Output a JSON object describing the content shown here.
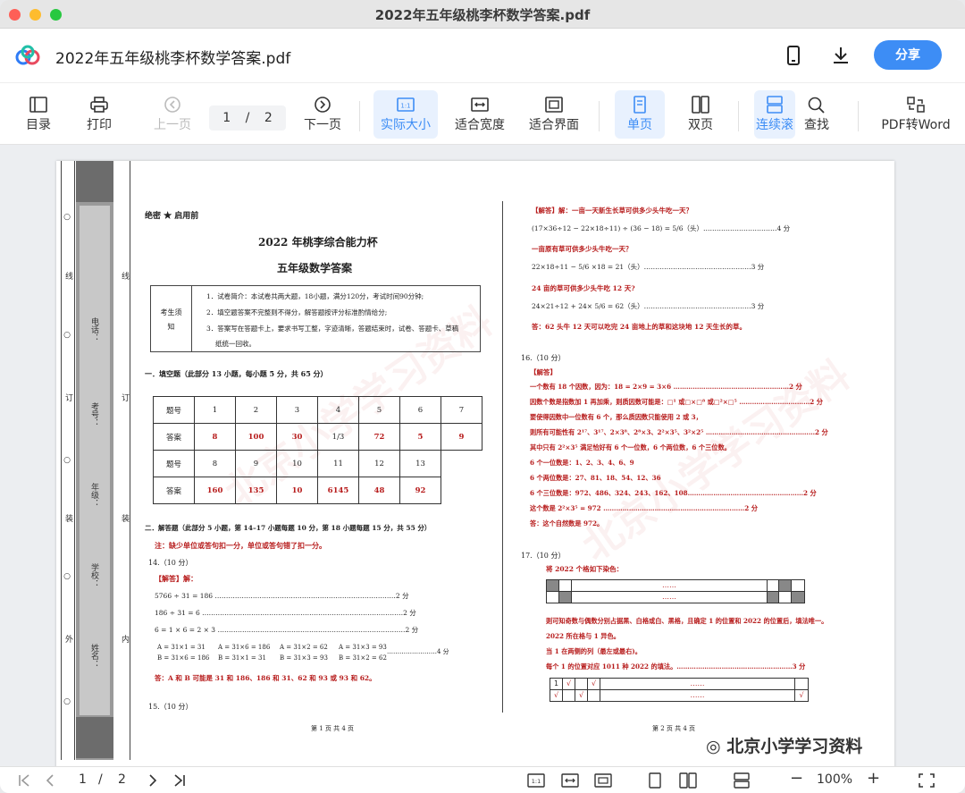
{
  "window": {
    "title": "2022年五年级桃李杯数学答案.pdf"
  },
  "header": {
    "doc_title": "2022年五年级桃李杯数学答案.pdf",
    "share_label": "分享"
  },
  "toolbar": {
    "toc": "目录",
    "print": "打印",
    "prev": "上一页",
    "page_current": "1",
    "page_sep": "/",
    "page_total": "2",
    "next": "下一页",
    "actual_size": "实际大小",
    "fit_width": "适合宽度",
    "fit_page": "适合界面",
    "single": "单页",
    "double": "双页",
    "continuous": "连续滚",
    "find": "查找",
    "pdf_to_word": "PDF转Word"
  },
  "left": {
    "confidential": "绝密 ★ 启用前",
    "title1": "2022 年桃李综合能力杯",
    "title2": "五年级数学答案",
    "notice_label": "考生须知",
    "notice": [
      "1．试卷简介：本试卷共两大题，18小题，满分120分，考试时间90分钟;",
      "2．填空题答案不完整则不得分，解答题按评分标准酌情给分;",
      "3．答案写在答题卡上，要求书写工整，字迹清晰，答题结束时，试卷、答题卡、草稿",
      "纸统一回收。"
    ],
    "sec1": "一．填空题（此部分 13 小题，每小题 5 分，共 65 分）",
    "table": {
      "row_label_q": "题号",
      "row_label_a": "答案",
      "q1": [
        "1",
        "2",
        "3",
        "4",
        "5",
        "6",
        "7"
      ],
      "a1": [
        "8",
        "100",
        "30",
        "1/3",
        "72",
        "5",
        "9"
      ],
      "q2": [
        "8",
        "9",
        "10",
        "11",
        "12",
        "13"
      ],
      "a2": [
        "160",
        "135",
        "10",
        "6145",
        "48",
        "92"
      ]
    },
    "sec2": "二．解答题（此部分 5 小题，第 14–17 小题每题 10 分，第 18 小题每题 15 分，共 55 分）",
    "note": "注：缺少单位或答句扣一分，单位或答句错了扣一分。",
    "q14": "14.（10 分）",
    "ans_label": "【解答】解：",
    "l1": "5766 ÷ 31 = 186 ………………………………………………………………………2 分",
    "l2": "186 ÷ 31 = 6 ………………………………………………………………………………2 分",
    "l3": "6 = 1 × 6 = 2 × 3 …………………………………………………………………………2 分",
    "eqs": [
      "A = 31×1 = 31  B = 31×6 = 186",
      "A = 31×6 = 186  B = 31×1 = 31",
      "A = 31×2 = 62  B = 31×3 = 93",
      "A = 31×3 = 93  B = 31×2 = 62"
    ],
    "eq_score": "……………………4 分",
    "ans14": "答：A 和 B 可能是 31 和 186、186 和 31、62 和 93 或 93 和 62。",
    "q15": "15.（10 分）",
    "footer": "第 1 页 共 4 页"
  },
  "binding": {
    "phone": "电话：",
    "exam_no": "考号：",
    "grade": "年级：",
    "school": "学校：",
    "name": "姓名：",
    "line": "线",
    "ding": "订",
    "zhuang": "装",
    "wai": "外",
    "nei": "内",
    "circles": "○"
  },
  "right": {
    "a1": "【解答】解：一亩一天新生长草可供多少头牛吃一天？",
    "e1": "(17×36÷12 − 22×18÷11) ÷ (36 − 18) = 5/6（头）……………………………4 分",
    "a2": "一亩原有草可供多少头牛吃一天？",
    "e2": "22×18÷11 − 5/6 ×18 = 21（头）…………………………………………3 分",
    "a3": "24 亩的草可供多少头牛吃 12 天?",
    "e3": "24×21÷12 + 24× 5/6 = 62（头）…………………………………………3 分",
    "ans15": "答：62 头牛 12 天可以吃完 24 亩地上的草和这块地 12 天生长的草。",
    "q16": "16.（10 分）",
    "ans_label": "【解答】",
    "s1": "一个数有 18 个因数，因为：18 = 2×9 = 3×6 ………………………………………………2 分",
    "s2": "因数个数是指数加 1 再加乘，则质因数可能是：□¹ 或□×□⁸ 或□²×□⁵ ……………………………2 分",
    "s3": "要使得因数中一位数有 6 个，那么质因数只能使用 2 或 3，",
    "s4": "则所有可能性有 2¹⁷、3¹⁷、2×3⁸、2⁸×3、2²×3⁵、3²×2⁵ ……………………………………………2 分",
    "s5": "其中只有 2²×3⁵ 满足恰好有 6 个一位数，6 个两位数，6 个三位数。",
    "s6": "6 个一位数是：1、2、3、4、6、9",
    "s7": "6 个两位数是：27、81、18、54、12、36",
    "s8": "6 个三位数是：972、486、324、243、162、108………………………………………………2 分",
    "s9": "这个数是 2²×3⁵ = 972 …………………………………………………………2 分",
    "s10": "答：这个自然数是 972。",
    "q17": "17.（10 分）",
    "t1": "将 2022 个格如下染色：",
    "dots": "……",
    "t2": "则可知奇数与偶数分别占据黑、白格或白、黑格，且确定 1 的位置和 2022 的位置后，填法唯一。",
    "t3": "2022 所在格与 1 异色。",
    "t4": "当 1 在两侧的列（最左或最右)。",
    "t5": "每个 1 的位置对应 1011 种 2022 的填法。………………………………………………3 分",
    "g1": "1",
    "check": "√",
    "footer": "第 2 页 共 4 页"
  },
  "statusbar": {
    "page_current": "1",
    "page_sep": "/",
    "page_total": "2",
    "zoom": "100%",
    "minus": "−",
    "plus": "+"
  },
  "watermark_text": "北京小学学习资料",
  "colors": {
    "accent": "#3d8df5",
    "answer_red": "#b71c1c"
  }
}
